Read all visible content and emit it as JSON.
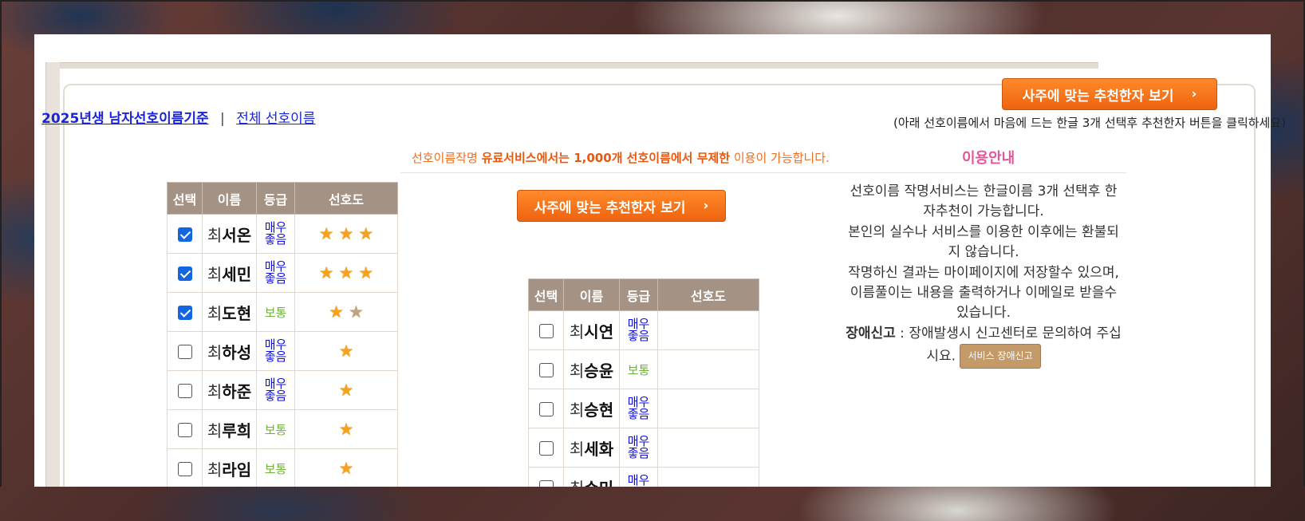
{
  "links": {
    "male_2025": "2025년생 남자선호이름기준",
    "separator": "|",
    "all": "전체 선호이름"
  },
  "top_button": {
    "label": "사주에 맞는 추천한자 보기"
  },
  "top_hint": "(아래 선호이름에서 마음에 드는 한글 3개 선택후 추천한자 버튼을 클릭하세요)",
  "table_headers": [
    "선택",
    "이름",
    "등급",
    "선호도"
  ],
  "left_table": [
    {
      "checked": true,
      "surname": "최",
      "given": "서온",
      "grade": "매우좋음",
      "grade_type": "great",
      "stars": 3
    },
    {
      "checked": true,
      "surname": "최",
      "given": "세민",
      "grade": "매우좋음",
      "grade_type": "great",
      "stars": 3
    },
    {
      "checked": true,
      "surname": "최",
      "given": "도현",
      "grade": "보통",
      "grade_type": "normal",
      "stars": 1.5
    },
    {
      "checked": false,
      "surname": "최",
      "given": "하성",
      "grade": "매우좋음",
      "grade_type": "great",
      "stars": 1
    },
    {
      "checked": false,
      "surname": "최",
      "given": "하준",
      "grade": "매우좋음",
      "grade_type": "great",
      "stars": 1
    },
    {
      "checked": false,
      "surname": "최",
      "given": "루희",
      "grade": "보통",
      "grade_type": "normal",
      "stars": 1
    },
    {
      "checked": false,
      "surname": "최",
      "given": "라임",
      "grade": "보통",
      "grade_type": "normal",
      "stars": 1
    }
  ],
  "notice": {
    "pre": "선호이름작명 ",
    "strong": "유료서비스에서는 1,000개 선호이름에서 무제한",
    "post": " 이용이 가능합니다."
  },
  "guide": {
    "title": "이용안내",
    "p1": "선호이름 작명서비스는 한글이름 3개 선택후 한자추천이 가능합니다.",
    "p2": "본인의 실수나 서비스를 이용한 이후에는 환불되지 않습니다.",
    "p3": "작명하신 결과는 마이페이지에 저장할수 있으며, 이름풀이는 내용을 출력하거나 이메일로 받을수 있습니다.",
    "report_label": "장애신고",
    "report_text": " : 장애발생시 신고센터로 문의하여 주십시요.",
    "report_button": "서비스 장애신고"
  },
  "mid_button": {
    "label": "사주에 맞는 추천한자 보기"
  },
  "right_table": [
    {
      "checked": false,
      "surname": "최",
      "given": "시연",
      "grade": "매우좋음",
      "grade_type": "great"
    },
    {
      "checked": false,
      "surname": "최",
      "given": "승윤",
      "grade": "보통",
      "grade_type": "normal"
    },
    {
      "checked": false,
      "surname": "최",
      "given": "승현",
      "grade": "매우좋음",
      "grade_type": "great"
    },
    {
      "checked": false,
      "surname": "최",
      "given": "세화",
      "grade": "매우좋음",
      "grade_type": "great"
    },
    {
      "checked": false,
      "surname": "최",
      "given": "수미",
      "grade": "매우좋음",
      "grade_type": "great"
    }
  ],
  "colors": {
    "accent_orange": "#ee6410",
    "header_brown": "#a49384",
    "link_blue": "#1a25d8",
    "grade_great": "#1111dd",
    "grade_normal": "#6fb13b",
    "guide_pink": "#e4569a"
  }
}
